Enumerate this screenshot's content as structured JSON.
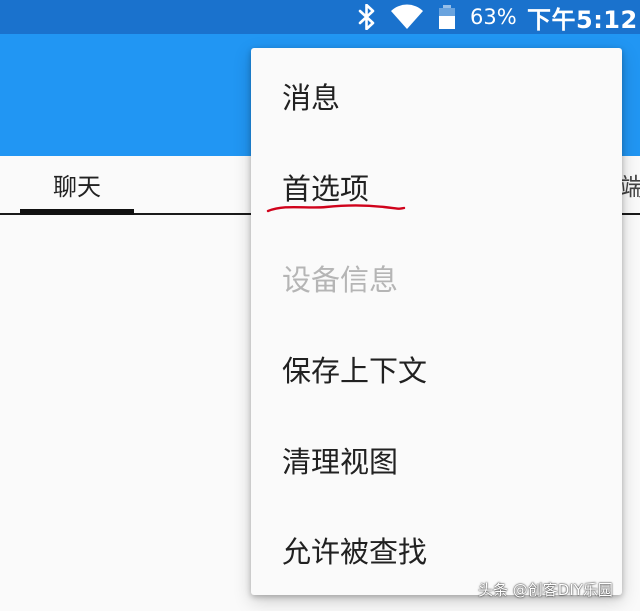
{
  "status_bar": {
    "background": "#1a72cd",
    "icons": [
      "bluetooth-icon",
      "wifi-icon",
      "battery-icon"
    ],
    "battery_text": "63%",
    "clock": "下午5:12"
  },
  "app_bar": {
    "background": "#2196f3"
  },
  "tabs": {
    "items": [
      {
        "label": "聊天",
        "selected": true
      },
      {
        "label": "端",
        "selected": false
      }
    ]
  },
  "overflow_menu": {
    "items": [
      {
        "label": "消息",
        "enabled": true
      },
      {
        "label": "首选项",
        "enabled": true,
        "annotated": true
      },
      {
        "label": "设备信息",
        "enabled": false
      },
      {
        "label": "保存上下文",
        "enabled": true
      },
      {
        "label": "清理视图",
        "enabled": true
      },
      {
        "label": "允许被查找",
        "enabled": true
      }
    ],
    "annotation_color": "#d0021b"
  },
  "watermark": {
    "text": "头条 @创客DIY乐园"
  }
}
